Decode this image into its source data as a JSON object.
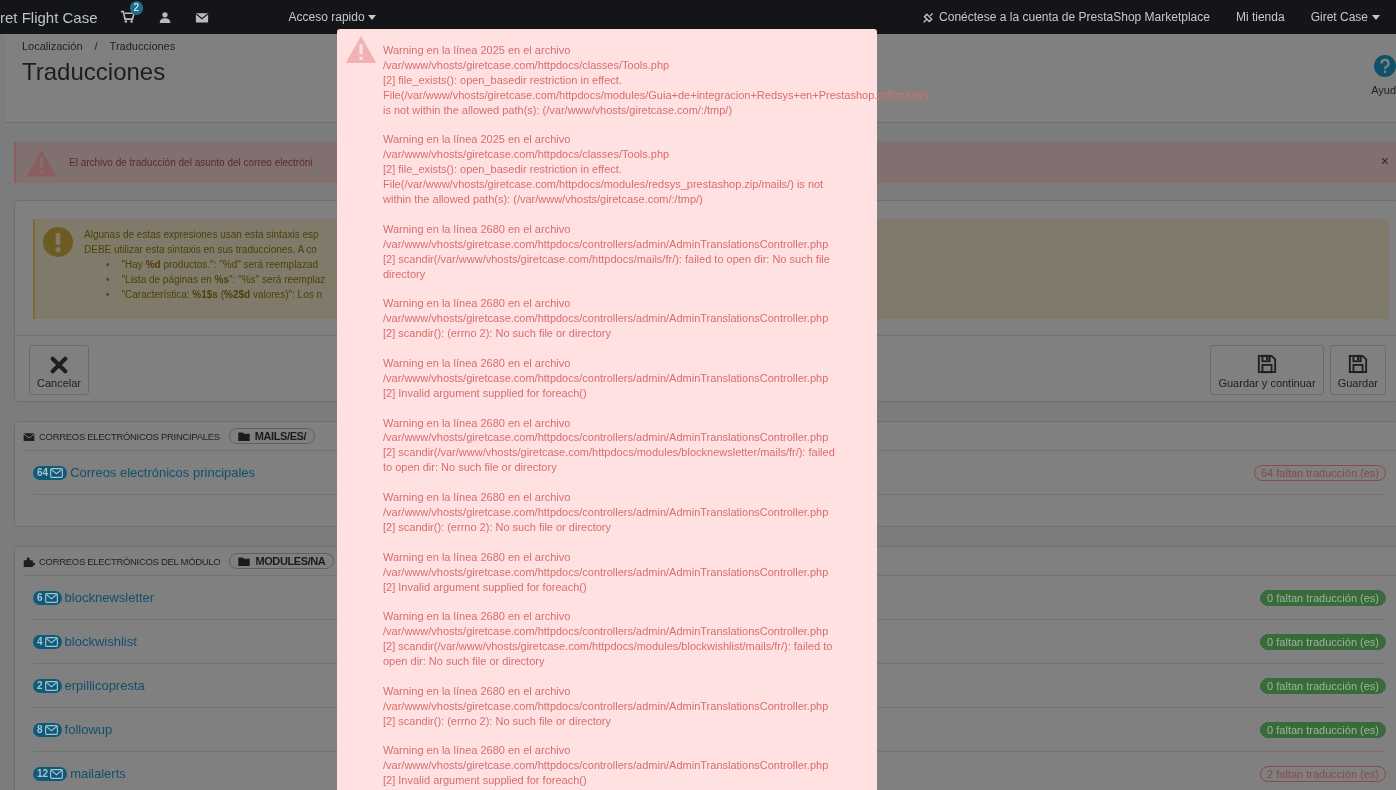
{
  "topbar": {
    "shop_name": "ret Flight Case",
    "cart_count": "2",
    "quick_access": "Acceso rapido",
    "marketplace_link": "Conéctese a la cuenta de PrestaShop Marketplace",
    "store_link": "Mi tienda",
    "user_menu": "Giret Case"
  },
  "header": {
    "breadcrumb": [
      "Localización",
      "Traducciones"
    ],
    "breadcrumb_separator": "/",
    "title": "Traducciones",
    "help_label": "Ayud"
  },
  "error_alert": {
    "text": "El archivo de traducción del asunto del correo electróni",
    "close": "×"
  },
  "syntax_warning": {
    "bullet": "•",
    "lines": [
      "Algunas de estas expresiones usan esta sintaxis esp",
      "DEBE utilizar esta sintaxis en sus traducciones. A co"
    ],
    "bullets": [
      "\"Hay **%d** productos.\": \"%d\" será reemplazad",
      "\"Lista de páginas en **%s**\": \"%s\" será reemplaz",
      "\"Característica: **%1$s** (**%2$d** valores)\": Los n"
    ]
  },
  "toolbar": {
    "buttons": [
      {
        "label": "Cancelar",
        "kind": "cancel"
      },
      {
        "label": "Guardar y continuar",
        "kind": "save"
      },
      {
        "label": "Guardar",
        "kind": "save"
      }
    ]
  },
  "sections": [
    {
      "kind": "main",
      "title": "CORREOS ELECTRÓNICOS PRINCIPALES",
      "folder": "MAILS/ES/",
      "rows": [
        {
          "count": "64",
          "name": "Correos electrónicos principales",
          "status": "64 faltan traducción (es)",
          "complete": false
        }
      ]
    },
    {
      "kind": "module",
      "title": "CORREOS ELECTRÓNICOS DEL MÓDULO",
      "folder": "MODULES/NA",
      "rows": [
        {
          "count": "6",
          "name": "blocknewsletter",
          "status": "0 faltan traducción (es)",
          "complete": true
        },
        {
          "count": "4",
          "name": "blockwishlist",
          "status": "0 faltan traducción (es)",
          "complete": true
        },
        {
          "count": "2",
          "name": "erpillicopresta",
          "status": "0 faltan traducción (es)",
          "complete": true
        },
        {
          "count": "8",
          "name": "followup",
          "status": "0 faltan traducción (es)",
          "complete": true
        },
        {
          "count": "12",
          "name": "mailalerts",
          "status": "2 faltan traducción (es)",
          "complete": false
        }
      ]
    }
  ],
  "error_modal": {
    "messages": [
      {
        "lines": [
          "Warning en la línea 2025 en el archivo",
          "/var/www/vhosts/giretcase.com/httpdocs/classes/Tools.php",
          "[2] file_exists(): open_basedir restriction in effect.",
          "File(/var/www/vhosts/giretcase.com/httpdocs/modules/Guia+de+integracion+Redsys+en+Prestashop.pdf/mails/)",
          "is not within the allowed path(s): (/var/www/vhosts/giretcase.com/:/tmp/)"
        ]
      },
      {
        "lines": [
          "Warning en la línea 2025 en el archivo",
          "/var/www/vhosts/giretcase.com/httpdocs/classes/Tools.php",
          "[2] file_exists(): open_basedir restriction in effect.",
          "File(/var/www/vhosts/giretcase.com/httpdocs/modules/redsys_prestashop.zip/mails/) is not",
          "within the allowed path(s): (/var/www/vhosts/giretcase.com/:/tmp/)"
        ]
      },
      {
        "lines": [
          "Warning en la línea 2680 en el archivo",
          "/var/www/vhosts/giretcase.com/httpdocs/controllers/admin/AdminTranslationsController.php",
          "[2] scandir(/var/www/vhosts/giretcase.com/httpdocs/mails/fr/): failed to open dir: No such file",
          "directory"
        ]
      },
      {
        "lines": [
          "Warning en la línea 2680 en el archivo",
          "/var/www/vhosts/giretcase.com/httpdocs/controllers/admin/AdminTranslationsController.php",
          "[2] scandir(): (errno 2): No such file or directory"
        ]
      },
      {
        "lines": [
          "Warning en la línea 2680 en el archivo",
          "/var/www/vhosts/giretcase.com/httpdocs/controllers/admin/AdminTranslationsController.php",
          "[2] Invalid argument supplied for foreach()"
        ]
      },
      {
        "lines": [
          "Warning en la línea 2680 en el archivo",
          "/var/www/vhosts/giretcase.com/httpdocs/controllers/admin/AdminTranslationsController.php",
          "[2] scandir(/var/www/vhosts/giretcase.com/httpdocs/modules/blocknewsletter/mails/fr/): failed",
          "to open dir: No such file or directory"
        ]
      },
      {
        "lines": [
          "Warning en la línea 2680 en el archivo",
          "/var/www/vhosts/giretcase.com/httpdocs/controllers/admin/AdminTranslationsController.php",
          "[2] scandir(): (errno 2): No such file or directory"
        ]
      },
      {
        "lines": [
          "Warning en la línea 2680 en el archivo",
          "/var/www/vhosts/giretcase.com/httpdocs/controllers/admin/AdminTranslationsController.php",
          "[2] Invalid argument supplied for foreach()"
        ]
      },
      {
        "lines": [
          "Warning en la línea 2680 en el archivo",
          "/var/www/vhosts/giretcase.com/httpdocs/controllers/admin/AdminTranslationsController.php",
          "[2] scandir(/var/www/vhosts/giretcase.com/httpdocs/modules/blockwishlist/mails/fr/): failed to",
          "open dir: No such file or directory"
        ]
      },
      {
        "lines": [
          "Warning en la línea 2680 en el archivo",
          "/var/www/vhosts/giretcase.com/httpdocs/controllers/admin/AdminTranslationsController.php",
          "[2] scandir(): (errno 2): No such file or directory"
        ]
      },
      {
        "lines": [
          "Warning en la línea 2680 en el archivo",
          "/var/www/vhosts/giretcase.com/httpdocs/controllers/admin/AdminTranslationsController.php",
          "[2] Invalid argument supplied for foreach()"
        ]
      }
    ]
  }
}
